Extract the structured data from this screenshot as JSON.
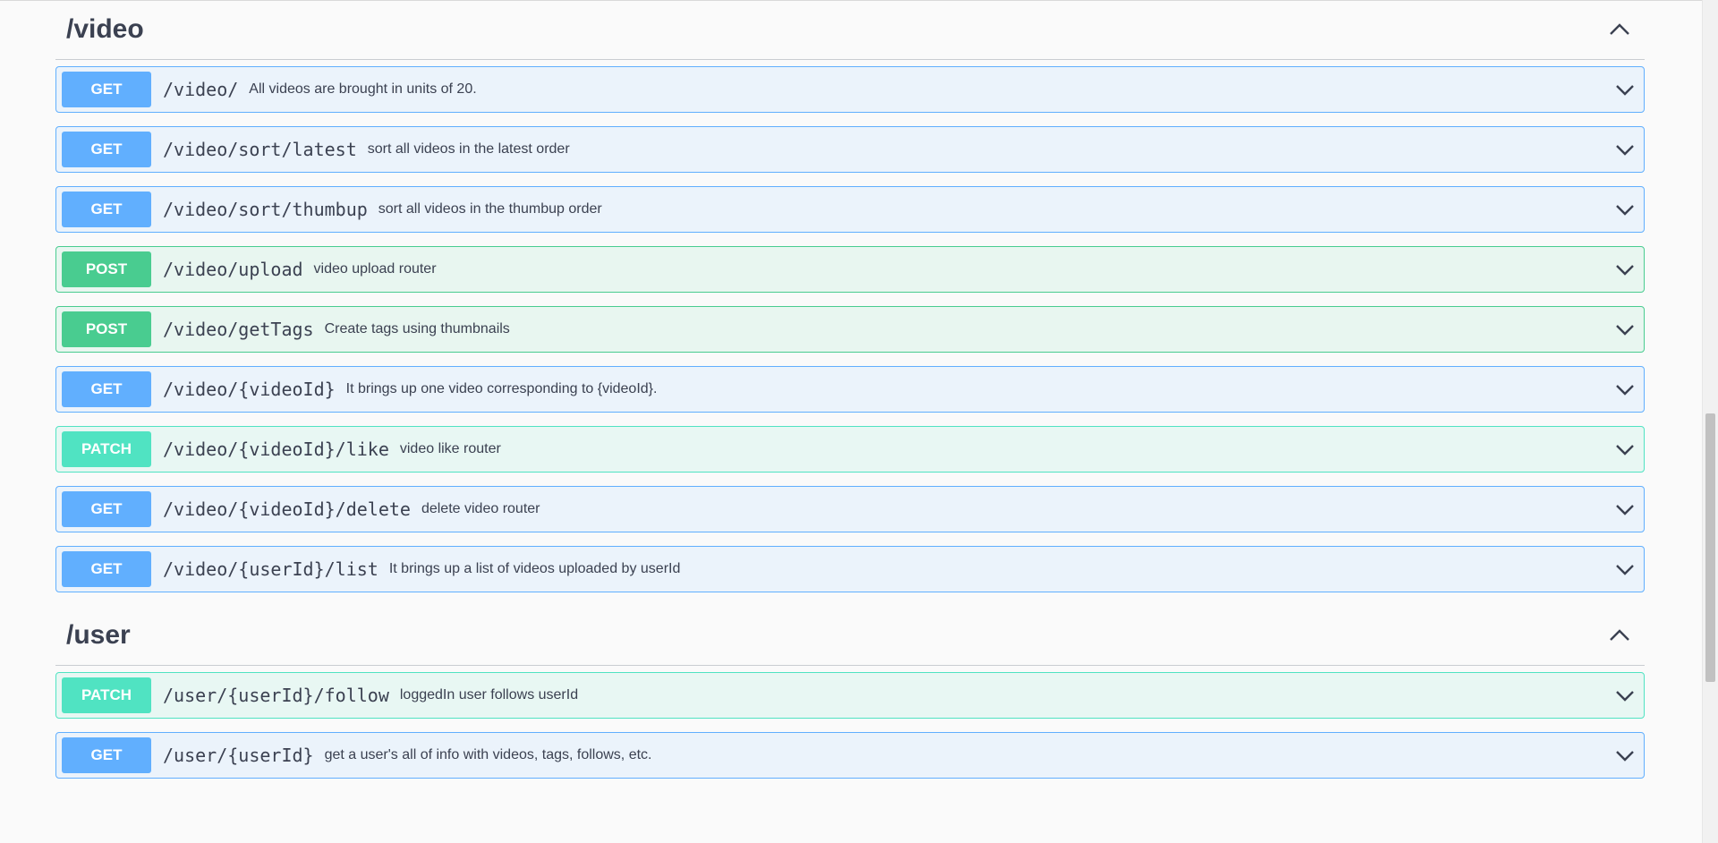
{
  "sections": [
    {
      "title": "/video",
      "operations": [
        {
          "method": "GET",
          "path": "/video/",
          "desc": "All videos are brought in units of 20."
        },
        {
          "method": "GET",
          "path": "/video/sort/latest",
          "desc": "sort all videos in the latest order"
        },
        {
          "method": "GET",
          "path": "/video/sort/thumbup",
          "desc": "sort all videos in the thumbup order"
        },
        {
          "method": "POST",
          "path": "/video/upload",
          "desc": "video upload router"
        },
        {
          "method": "POST",
          "path": "/video/getTags",
          "desc": "Create tags using thumbnails"
        },
        {
          "method": "GET",
          "path": "/video/{videoId}",
          "desc": "It brings up one video corresponding to {videoId}."
        },
        {
          "method": "PATCH",
          "path": "/video/{videoId}/like",
          "desc": "video like router"
        },
        {
          "method": "GET",
          "path": "/video/{videoId}/delete",
          "desc": "delete video router"
        },
        {
          "method": "GET",
          "path": "/video/{userId}/list",
          "desc": "It brings up a list of videos uploaded by userId"
        }
      ]
    },
    {
      "title": "/user",
      "operations": [
        {
          "method": "PATCH",
          "path": "/user/{userId}/follow",
          "desc": "loggedIn user follows userId"
        },
        {
          "method": "GET",
          "path": "/user/{userId}",
          "desc": "get a user's all of info with videos, tags, follows, etc."
        }
      ]
    }
  ],
  "colors": {
    "get": "#61affe",
    "post": "#49cc90",
    "patch": "#50e3c2"
  },
  "icons": {
    "section_toggle": "chevron-up-icon",
    "operation_toggle": "chevron-down-icon"
  }
}
